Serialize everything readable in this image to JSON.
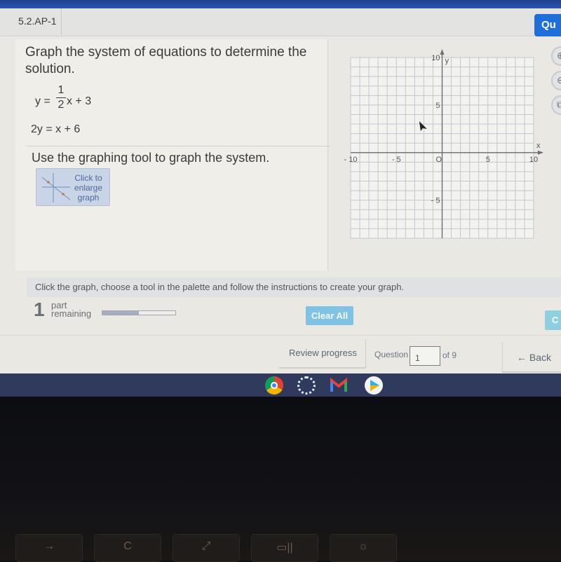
{
  "header": {
    "question_id": "5.2.AP-1",
    "help_button_label": "Qu"
  },
  "problem": {
    "prompt": "Graph the system of equations to determine the solution.",
    "equation1": {
      "lhs": "y =",
      "numerator": "1",
      "denominator": "2",
      "rhs": "x + 3"
    },
    "equation2": "2y = x + 6",
    "instruction": "Use the graphing tool to graph the system.",
    "enlarge_button_label": "Click to enlarge graph"
  },
  "graph": {
    "x_axis_label": "x",
    "y_axis_label": "y",
    "origin_label": "O",
    "x_range": [
      -10,
      10
    ],
    "y_range": [
      -9,
      10
    ],
    "x_tick_labels": [
      "- 10",
      "- 5",
      "5",
      "10"
    ],
    "x_tick_values": [
      -10,
      -5,
      5,
      10
    ],
    "y_tick_labels": [
      "10",
      "5",
      "- 5"
    ],
    "y_tick_values": [
      10,
      5,
      -5
    ],
    "grid_step": 1
  },
  "side_tools": [
    {
      "icon": "zoom-in-icon",
      "glyph": "⊕"
    },
    {
      "icon": "zoom-out-icon",
      "glyph": "⊖"
    },
    {
      "icon": "pop-out-icon",
      "glyph": "⧉"
    }
  ],
  "status": {
    "instruction_bar": "Click the graph, choose a tool in the palette and follow the instructions to create your graph.",
    "parts_remaining_count": "1",
    "parts_remaining_label_1": "part",
    "parts_remaining_label_2": "remaining",
    "progress_fraction": 0.5,
    "clear_all_label": "Clear All",
    "check_answer_label": "C"
  },
  "footer": {
    "review_progress_label": "Review progress",
    "question_label": "Question",
    "question_value": "1",
    "of_label": "of 9",
    "back_label": "← Back"
  },
  "shelf": {
    "apps": [
      "chrome",
      "launcher",
      "gmail",
      "play-store"
    ]
  },
  "keyboard": {
    "keys": [
      "→",
      "C",
      "⤢",
      "▭||",
      "☼"
    ]
  }
}
